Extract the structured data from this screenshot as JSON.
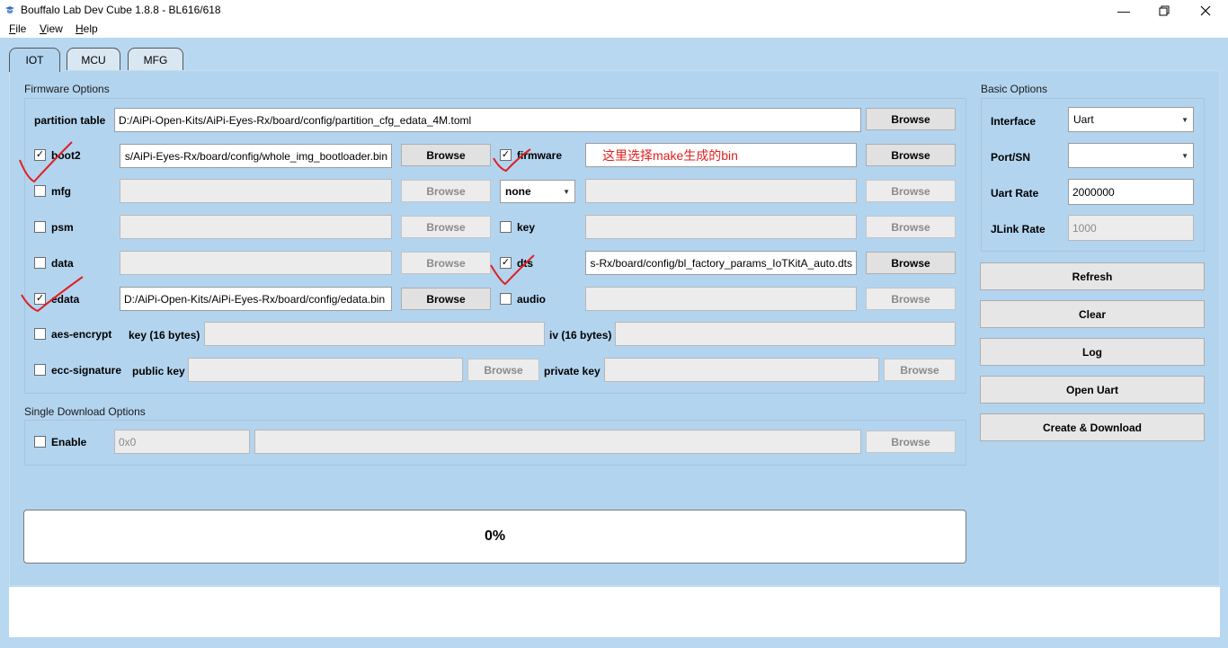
{
  "window": {
    "title": "Bouffalo Lab Dev Cube 1.8.8 - BL616/618"
  },
  "menu": [
    {
      "accel": "F",
      "rest": "ile"
    },
    {
      "accel": "V",
      "rest": "iew"
    },
    {
      "accel": "H",
      "rest": "elp"
    }
  ],
  "tabs": [
    "IOT",
    "MCU",
    "MFG"
  ],
  "firmware_options": {
    "title": "Firmware Options",
    "partition_table": {
      "label": "partition table",
      "path": "D:/AiPi-Open-Kits/AiPi-Eyes-Rx/board/config/partition_cfg_edata_4M.toml",
      "button": "Browse"
    },
    "boot2": {
      "label": "boot2",
      "checked": true,
      "path": "s/AiPi-Eyes-Rx/board/config/whole_img_bootloader.bin",
      "button": "Browse"
    },
    "mfg": {
      "label": "mfg",
      "checked": false,
      "path": "",
      "button": "Browse"
    },
    "psm": {
      "label": "psm",
      "checked": false,
      "path": "",
      "button": "Browse"
    },
    "data": {
      "label": "data",
      "checked": false,
      "path": "",
      "button": "Browse"
    },
    "edata": {
      "label": "edata",
      "checked": true,
      "path": "D:/AiPi-Open-Kits/AiPi-Eyes-Rx/board/config/edata.bin",
      "button": "Browse"
    },
    "firmware": {
      "label": "firmware",
      "checked": true,
      "path": "",
      "button": "Browse"
    },
    "firmware_select": {
      "value": "none"
    },
    "key": {
      "label": "key",
      "checked": false,
      "path": "",
      "button": "Browse"
    },
    "dts": {
      "label": "dts",
      "checked": true,
      "path": "s-Rx/board/config/bl_factory_params_IoTKitA_auto.dts",
      "button": "Browse"
    },
    "audio": {
      "label": "audio",
      "checked": false,
      "path": "",
      "button": "Browse"
    },
    "aes_encrypt": {
      "label": "aes-encrypt",
      "checked": false,
      "key_label": "key (16 bytes)",
      "key": "",
      "iv_label": "iv (16 bytes)",
      "iv": ""
    },
    "ecc_signature": {
      "label": "ecc-signature",
      "checked": false,
      "public_key_label": "public key",
      "public_key": "",
      "private_key_label": "private key",
      "private_key": "",
      "button": "Browse"
    }
  },
  "single_download": {
    "title": "Single Download Options",
    "enable": {
      "label": "Enable",
      "checked": false
    },
    "address_placeholder": "0x0",
    "path": "",
    "button": "Browse"
  },
  "basic_options": {
    "title": "Basic Options",
    "interface": {
      "label": "Interface",
      "value": "Uart"
    },
    "port": {
      "label": "Port/SN",
      "value": ""
    },
    "uart_rate": {
      "label": "Uart Rate",
      "value": "2000000"
    },
    "jlink_rate": {
      "label": "JLink Rate",
      "value": "1000"
    }
  },
  "actions": {
    "refresh": "Refresh",
    "clear": "Clear",
    "log": "Log",
    "open_uart": "Open Uart",
    "create_download": "Create & Download"
  },
  "progress": {
    "text": "0%",
    "value": 0
  },
  "annotation": {
    "text": "这里选择make生成的bin",
    "color": "#e02020"
  },
  "colors": {
    "background": "#b8d7f0",
    "annotation": "#e02020"
  }
}
